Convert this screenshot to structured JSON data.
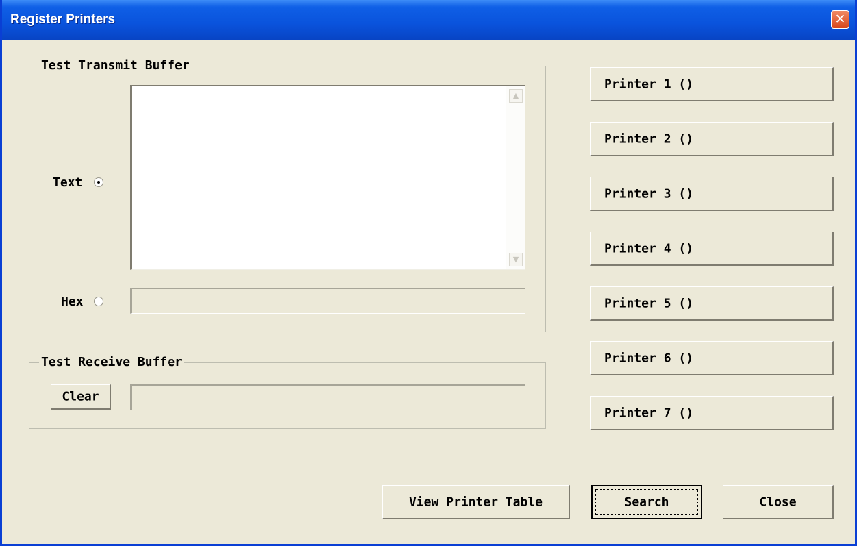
{
  "window": {
    "title": "Register Printers",
    "close_glyph": "✕"
  },
  "transmit": {
    "group_label": "Test Transmit Buffer",
    "text_label": "Text",
    "hex_label": "Hex",
    "text_selected": true,
    "text_value": "",
    "hex_value": ""
  },
  "receive": {
    "group_label": "Test Receive Buffer",
    "clear_label": "Clear",
    "value": ""
  },
  "printers": [
    {
      "label": "Printer 1 ()"
    },
    {
      "label": "Printer 2 ()"
    },
    {
      "label": "Printer 3 ()"
    },
    {
      "label": "Printer 4 ()"
    },
    {
      "label": "Printer 5 ()"
    },
    {
      "label": "Printer 6 ()"
    },
    {
      "label": "Printer 7 ()"
    }
  ],
  "footer": {
    "view_table_label": "View Printer Table",
    "search_label": "Search",
    "close_label": "Close"
  },
  "colors": {
    "dialog_bg": "#ece9d8",
    "titlebar_blue": "#0a53dc",
    "close_red": "#d8461c"
  }
}
